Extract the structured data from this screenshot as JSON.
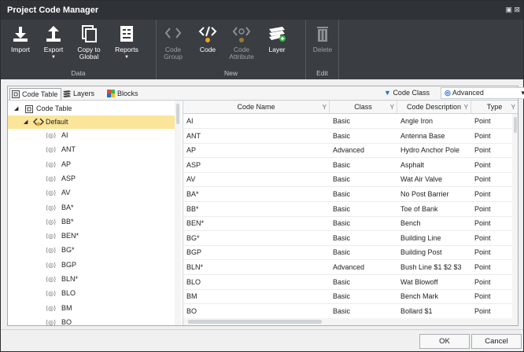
{
  "window": {
    "title": "Project Code Manager",
    "controls": "▣ ⊠"
  },
  "ribbon": {
    "groups": [
      {
        "label": "Data"
      },
      {
        "label": "New"
      },
      {
        "label": "Edit"
      }
    ],
    "buttons": {
      "import": "Import",
      "export": "Export",
      "copy_global_1": "Copy to",
      "copy_global_2": "Global",
      "reports": "Reports",
      "code_group_1": "Code",
      "code_group_2": "Group",
      "code": "Code",
      "code_attr_1": "Code",
      "code_attr_2": "Attribute",
      "layer": "Layer",
      "delete": "Delete"
    }
  },
  "tabs": {
    "code_table": "Code Table",
    "layers": "Layers",
    "blocks": "Blocks"
  },
  "filter": {
    "code_class_label": "Code Class",
    "selected": "Advanced"
  },
  "tree": {
    "root": "Code Table",
    "group": "Default",
    "items": [
      "AI",
      "ANT",
      "AP",
      "ASP",
      "AV",
      "BA*",
      "BB*",
      "BEN*",
      "BG*",
      "BGP",
      "BLN*",
      "BLO",
      "BM",
      "BO"
    ]
  },
  "grid": {
    "headers": {
      "name": "Code Name",
      "class": "Class",
      "desc": "Code Description",
      "type": "Type"
    },
    "rows": [
      [
        "AI",
        "Basic",
        "Angle Iron",
        "Point"
      ],
      [
        "ANT",
        "Basic",
        "Antenna Base",
        "Point"
      ],
      [
        "AP",
        "Advanced",
        "Hydro Anchor Pole",
        "Point"
      ],
      [
        "ASP",
        "Basic",
        "Asphalt",
        "Point"
      ],
      [
        "AV",
        "Basic",
        "Wat Air Valve",
        "Point"
      ],
      [
        "BA*",
        "Basic",
        "No Post Barrier",
        "Point"
      ],
      [
        "BB*",
        "Basic",
        "Toe of Bank",
        "Point"
      ],
      [
        "BEN*",
        "Basic",
        "Bench",
        "Point"
      ],
      [
        "BG*",
        "Basic",
        "Building Line",
        "Point"
      ],
      [
        "BGP",
        "Basic",
        "Building Post",
        "Point"
      ],
      [
        "BLN*",
        "Advanced",
        "Bush Line $1 $2 $3",
        "Point"
      ],
      [
        "BLO",
        "Basic",
        "Wat Blowoff",
        "Point"
      ],
      [
        "BM",
        "Basic",
        "Bench Mark",
        "Point"
      ],
      [
        "BO",
        "Basic",
        "Bollard $1",
        "Point"
      ]
    ]
  },
  "footer": {
    "ok": "OK",
    "cancel": "Cancel"
  },
  "colors": {
    "titlebar": "#2f3337",
    "ribbon": "#3a3e43",
    "selection": "#fbe59a",
    "accent_orange": "#f0a020",
    "accent_blue": "#1b6fd6"
  }
}
